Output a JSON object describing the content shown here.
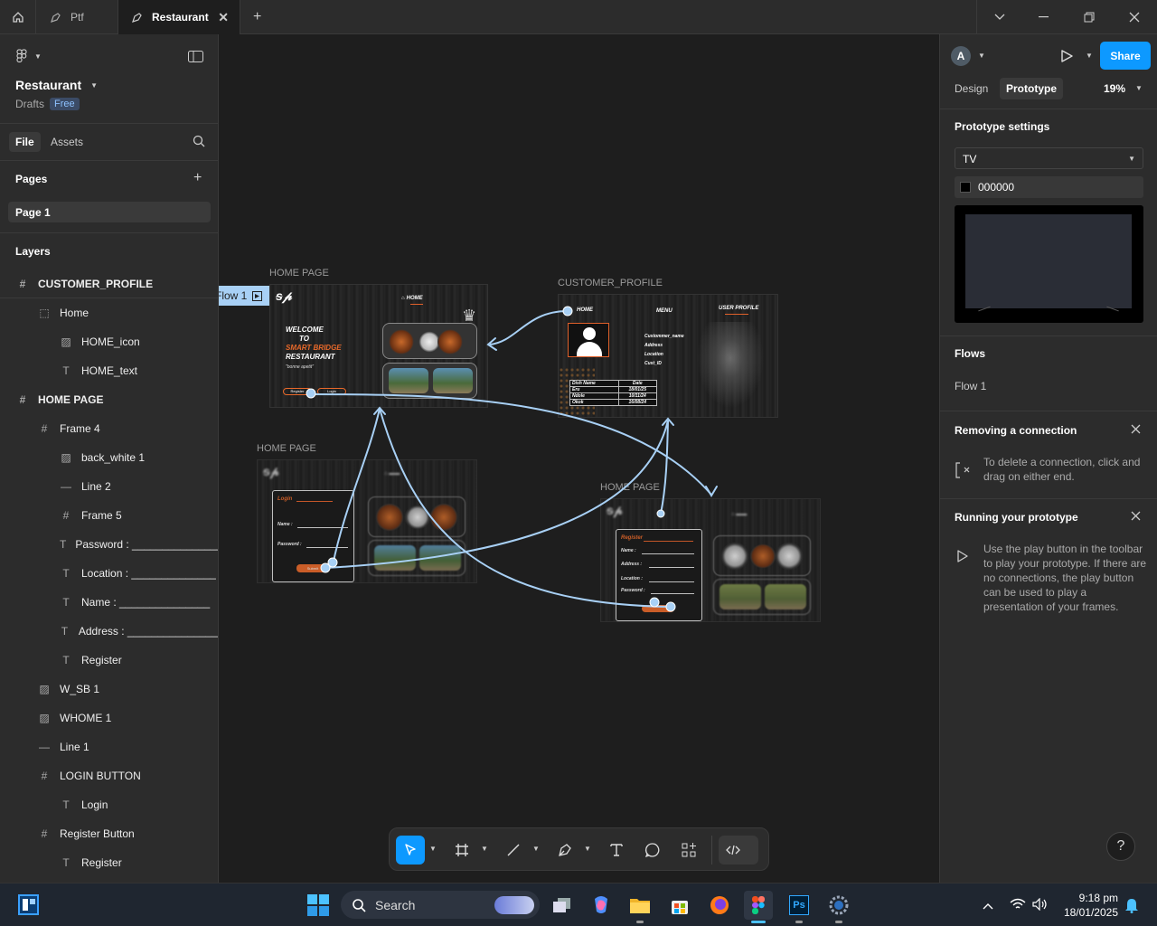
{
  "tabs": {
    "tab1": "Ptf",
    "tab2": "Restaurant"
  },
  "left": {
    "file_name": "Restaurant",
    "drafts": "Drafts",
    "plan_badge": "Free",
    "tab_file": "File",
    "tab_assets": "Assets",
    "pages_title": "Pages",
    "page1": "Page 1",
    "layers_title": "Layers",
    "layers": [
      "CUSTOMER_PROFILE",
      "Home",
      "HOME_icon",
      "HOME_text",
      "HOME PAGE",
      "Frame 4",
      "back_white 1",
      "Line 2",
      "Frame 5",
      "Password : _______________",
      "Location : ______________",
      "Name : _______________",
      "Address : _______________",
      "Register",
      "W_SB 1",
      "WHOME 1",
      "Line 1",
      "LOGIN BUTTON",
      "Login",
      "Register Button",
      "Register"
    ]
  },
  "canvas": {
    "flow_tag": "Flow 1",
    "frame_home": "HOME PAGE",
    "frame_customer": "CUSTOMER_PROFILE",
    "frame_login": "HOME PAGE",
    "frame_register": "HOME PAGE",
    "home": {
      "nav": "HOME",
      "welcome1": "WELCOME",
      "welcome2": "TO",
      "welcome3": "SMART BRIDGE",
      "welcome4": "RESTAURANT",
      "tagline": "\"bonne apetit\"",
      "register_btn": "Register",
      "login_btn": "Login"
    },
    "customer": {
      "nav_home": "HOME",
      "nav_menu": "MENU",
      "nav_profile": "USER PROFILE",
      "fields": [
        "Custommer_name",
        "Address",
        "Location",
        "Cust_ID"
      ],
      "table_headers": [
        "Dish Name",
        "Date"
      ],
      "table_rows": [
        [
          "Eru",
          "18/01/25"
        ],
        [
          "Ndole",
          "10/11/24"
        ],
        [
          "Okok",
          "16/08/24"
        ]
      ]
    },
    "login": {
      "title": "Login",
      "name": "Name :",
      "password": "Password :",
      "submit": "Submit"
    },
    "register": {
      "title": "Register",
      "fields": [
        "Name :",
        "Address :",
        "Location :",
        "Password :"
      ]
    }
  },
  "right": {
    "avatar": "A",
    "share": "Share",
    "tab_design": "Design",
    "tab_prototype": "Prototype",
    "zoom": "19%",
    "proto_settings": "Prototype settings",
    "device": "TV",
    "bg_color": "000000",
    "flows_title": "Flows",
    "flow1": "Flow 1",
    "remove_title": "Removing a connection",
    "remove_text": "To delete a connection, click and drag on either end.",
    "run_title": "Running your prototype",
    "run_text": "Use the play button in the toolbar to play your prototype. If there are no connections, the play button can be used to play a presentation of your frames."
  },
  "taskbar": {
    "search": "Search",
    "time": "9:18 pm",
    "date": "18/01/2025"
  },
  "help": "?"
}
